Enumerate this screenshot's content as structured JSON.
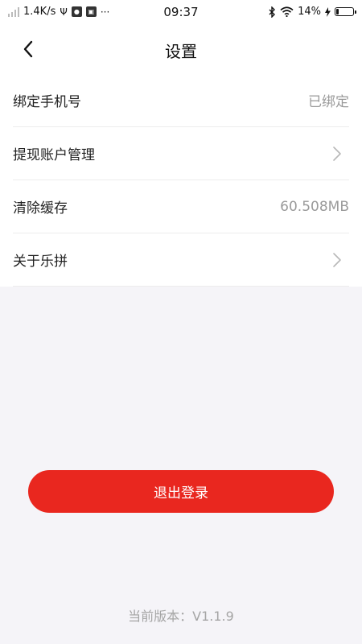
{
  "status_bar": {
    "speed": "1.4K/s",
    "time": "09:37",
    "battery_percent": "14%",
    "battery_level": 0.14,
    "icons": [
      "signal-icon",
      "usb-icon",
      "notification-icon",
      "screenshot-icon",
      "more-icon",
      "bluetooth-icon",
      "wifi-icon",
      "charging-icon",
      "battery-icon"
    ]
  },
  "nav": {
    "title": "设置",
    "back_icon": "chevron-left-icon"
  },
  "settings": {
    "items": [
      {
        "label": "绑定手机号",
        "value": "已绑定"
      },
      {
        "label": "提现账户管理",
        "icon": "chevron-right-icon"
      },
      {
        "label": "清除缓存",
        "value": "60.508MB"
      },
      {
        "label": "关于乐拼",
        "icon": "chevron-right-icon"
      }
    ]
  },
  "logout": {
    "label": "退出登录"
  },
  "footer": {
    "version_text": "当前版本：V1.1.9"
  },
  "colors": {
    "accent": "#e9271f",
    "background": "#f5f4f8",
    "secondary_text": "#9a9a9a"
  }
}
